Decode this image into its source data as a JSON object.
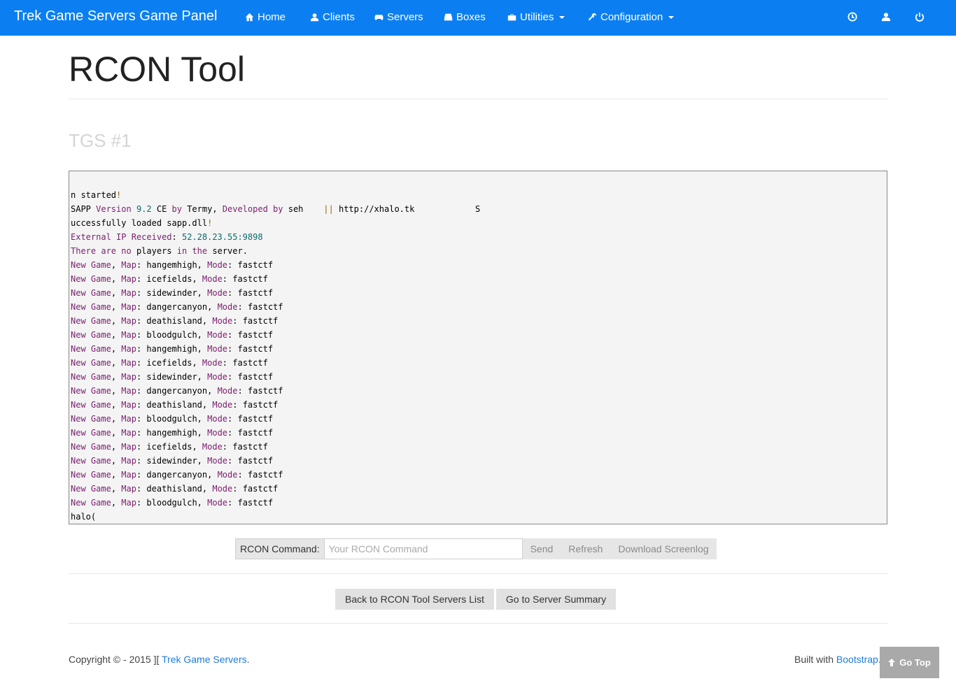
{
  "nav": {
    "brand": "Trek Game Servers Game Panel",
    "items": [
      {
        "label": "Home",
        "icon": "home-icon"
      },
      {
        "label": "Clients",
        "icon": "user-icon"
      },
      {
        "label": "Servers",
        "icon": "gamepad-icon"
      },
      {
        "label": "Boxes",
        "icon": "hdd-icon"
      },
      {
        "label": "Utilities",
        "icon": "briefcase-icon",
        "dropdown": true
      },
      {
        "label": "Configuration",
        "icon": "wrench-icon",
        "dropdown": true
      }
    ],
    "right_icons": [
      "clock-icon",
      "user-icon",
      "power-icon"
    ]
  },
  "page": {
    "title": "RCON Tool",
    "server_name": "TGS #1"
  },
  "console": {
    "lines": [
      "n started!",
      "SAPP Version 9.2 CE by Termy, Developed by seh    || http://xhalo.tk            S",
      "uccessfully loaded sapp.dll!",
      "External IP Received: 52.28.23.55:9898",
      "There are no players in the server.",
      "New Game, Map: hangemhigh, Mode: fastctf",
      "New Game, Map: icefields, Mode: fastctf",
      "New Game, Map: sidewinder, Mode: fastctf",
      "New Game, Map: dangercanyon, Mode: fastctf",
      "New Game, Map: deathisland, Mode: fastctf",
      "New Game, Map: bloodgulch, Mode: fastctf",
      "New Game, Map: hangemhigh, Mode: fastctf",
      "New Game, Map: icefields, Mode: fastctf",
      "New Game, Map: sidewinder, Mode: fastctf",
      "New Game, Map: dangercanyon, Mode: fastctf",
      "New Game, Map: deathisland, Mode: fastctf",
      "New Game, Map: bloodgulch, Mode: fastctf",
      "New Game, Map: hangemhigh, Mode: fastctf",
      "New Game, Map: icefields, Mode: fastctf",
      "New Game, Map: sidewinder, Mode: fastctf",
      "New Game, Map: dangercanyon, Mode: fastctf",
      "New Game, Map: deathisland, Mode: fastctf",
      "New Game, Map: bloodgulch, Mode: fastctf",
      "halo("
    ]
  },
  "command": {
    "label": "RCON Command:",
    "placeholder": "Your RCON Command",
    "value": "",
    "send_label": "Send",
    "refresh_label": "Refresh",
    "download_label": "Download Screenlog"
  },
  "actions": {
    "back_label": "Back to RCON Tool Servers List",
    "summary_label": "Go to Server Summary"
  },
  "footer": {
    "copyright_prefix": "Copyright © - 2015 ][ ",
    "company_link": "Trek Game Servers",
    "copyright_suffix": ".",
    "built_prefix": "Built with ",
    "bootstrap_link": "Bootstrap",
    "built_suffix": ".",
    "go_top_label": "Go Top"
  },
  "colors": {
    "navbar_bg": "#0b7ff2",
    "console_bg": "#f4f4f4",
    "link": "#1f7bd8"
  }
}
